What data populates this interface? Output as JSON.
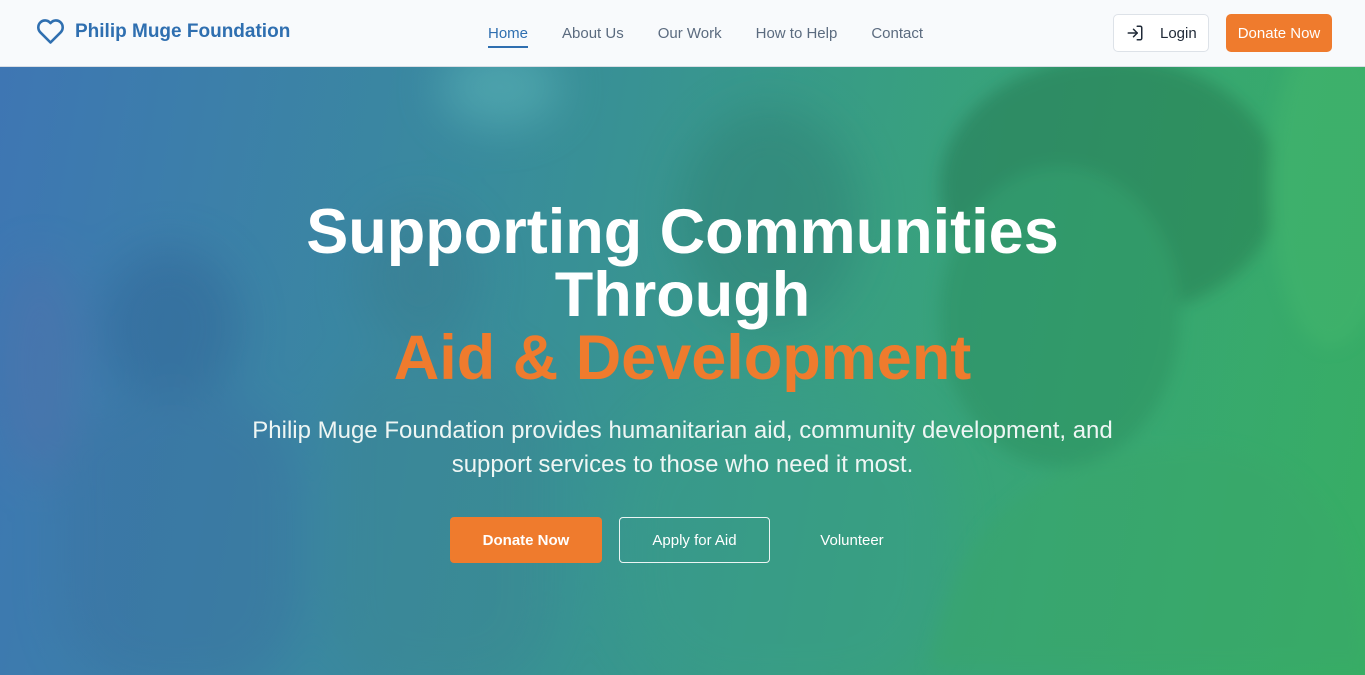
{
  "brand": {
    "name": "Philip Muge Foundation",
    "icon": "heart-icon",
    "color": "#2f6fb0"
  },
  "nav": {
    "links": [
      {
        "label": "Home",
        "active": true
      },
      {
        "label": "About Us",
        "active": false
      },
      {
        "label": "Our Work",
        "active": false
      },
      {
        "label": "How to Help",
        "active": false
      },
      {
        "label": "Contact",
        "active": false
      }
    ],
    "login_label": "Login",
    "login_icon": "login-icon",
    "donate_label": "Donate Now"
  },
  "hero": {
    "title_line1": "Supporting Communities",
    "title_line2": "Through",
    "title_highlight": "Aid & Development",
    "subtitle": "Philip Muge Foundation provides humanitarian aid, community development, and support services to those who need it most.",
    "buttons": {
      "donate": "Donate Now",
      "apply": "Apply for Aid",
      "volunteer": "Volunteer"
    },
    "background_image": "photo-of-smiling-young-people-blurred"
  },
  "colors": {
    "accent": "#ef7b2d",
    "primary": "#2f6fb0",
    "hero_gradient_start": "#3f78b3",
    "hero_gradient_end": "#37ad64"
  }
}
